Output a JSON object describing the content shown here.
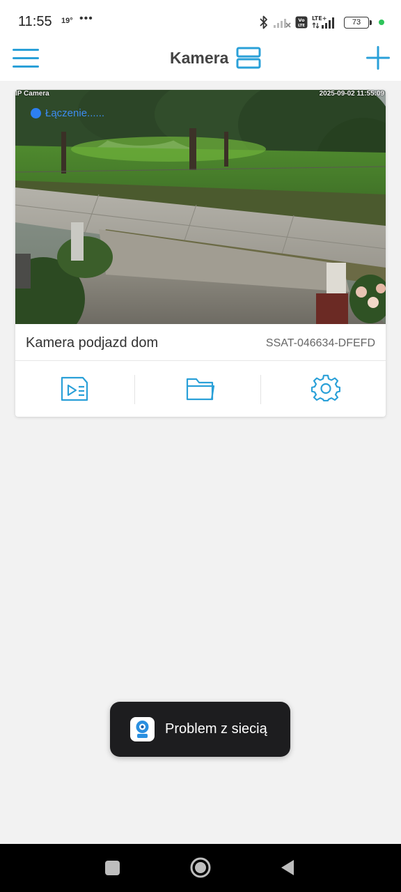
{
  "status_bar": {
    "time": "11:55",
    "temperature": "19°",
    "more": "•••",
    "network_label": "LTE+",
    "volte_label": "Vo LTE",
    "battery_level": "73"
  },
  "header": {
    "title": "Kamera",
    "accent_color": "#2aa0d8"
  },
  "camera": {
    "osd_label": "IP Camera",
    "timestamp": "2025-09-02 11:55:09",
    "connecting_text": "Łączenie......",
    "name": "Kamera podjazd dom",
    "uid": "SSAT-046634-DFEFD",
    "actions": [
      "playback-icon",
      "folder-icon",
      "settings-icon"
    ]
  },
  "toast": {
    "message": "Problem z siecią"
  },
  "nav_bar": {
    "buttons": [
      "recent-apps",
      "home",
      "back"
    ]
  }
}
